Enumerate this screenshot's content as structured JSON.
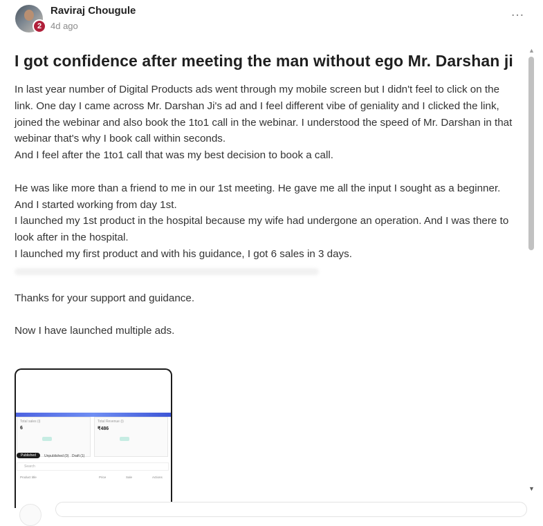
{
  "post": {
    "author": "Raviraj Chougule",
    "level": "2",
    "time": "4d ago",
    "menu_icon": "…",
    "title": "I got confidence after meeting the man without ego Mr. Darshan ji",
    "paragraphs": [
      "In last year number of Digital Products ads went through my mobile screen but I didn't feel to click on the link. One day I came across Mr. Darshan Ji's ad and I feel different vibe of geniality and I clicked the link, joined the webinar and also book the 1to1 call in the webinar. I understood the speed of Mr. Darshan in that webinar that's why I book call within seconds.",
      "And I feel after the 1to1 call that was my best decision to book a call.",
      "He was like more than a friend to me in our 1st meeting. He gave me all the input I sought as a beginner.",
      "And I started working from day 1st.",
      "I launched my 1st product in the hospital because my wife had undergone an operation. And I was there to look after in the hospital.",
      "I launched my first product and with his guidance, I got 6 sales in 3 days.",
      "Thanks for your support and guidance.",
      "Now I have launched multiple ads."
    ]
  },
  "screenshot": {
    "card1_label": "Total sales (i)",
    "card1_value": "6",
    "card2_label": "Total Revenue (i)",
    "card2_value": "₹486",
    "tab_active": "Published",
    "tab2": "Unpublished (0)",
    "tab3": "Draft (1)",
    "search_placeholder": "Search",
    "col1": "Product title",
    "col2": "Price",
    "col3": "Sale",
    "col4": "Actions"
  },
  "colors": {
    "badge": "#b0203a",
    "accent_band": "#4d63e0"
  }
}
